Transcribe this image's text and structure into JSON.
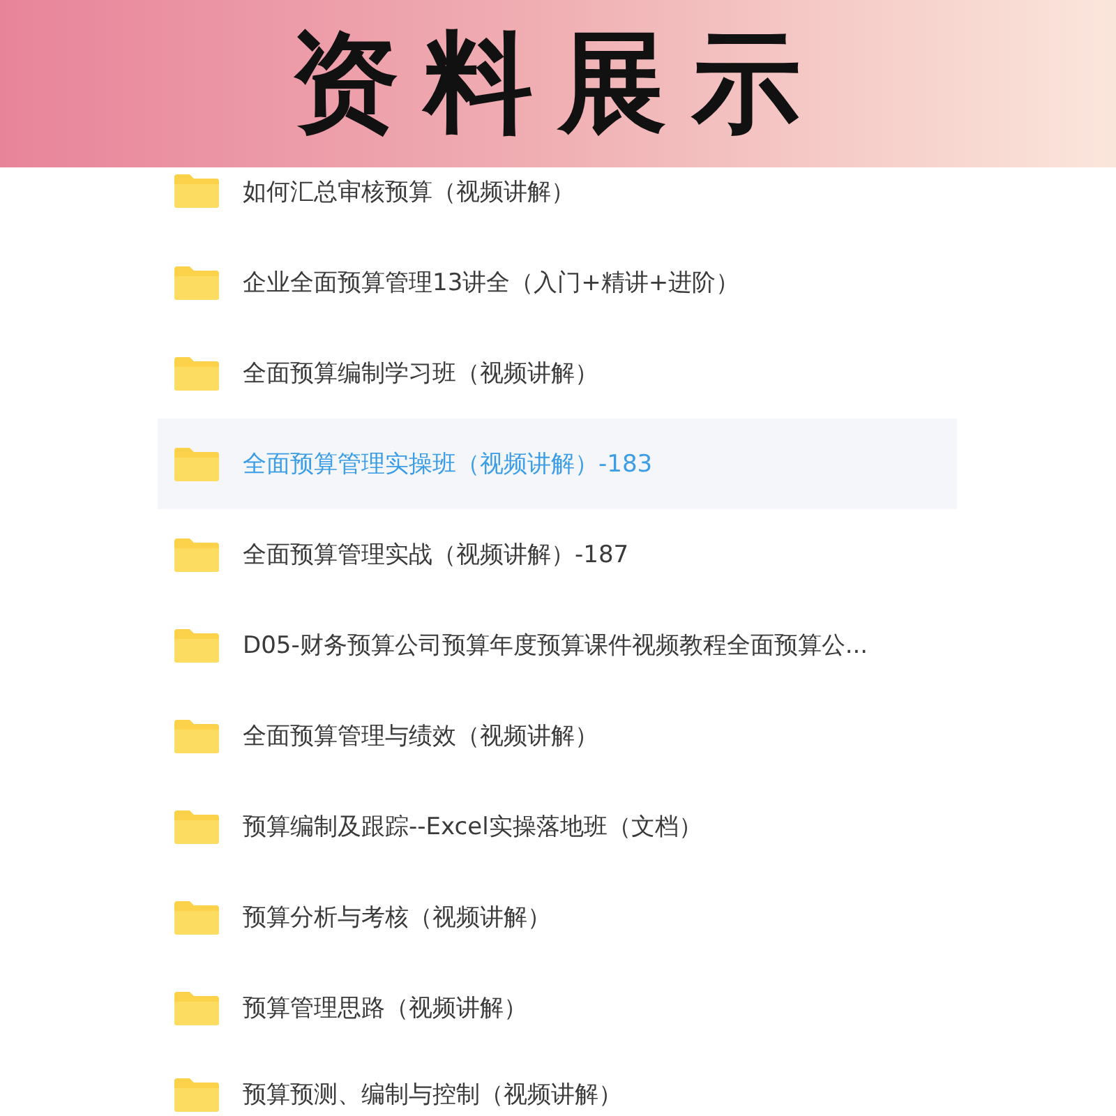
{
  "banner": {
    "title": "资料展示"
  },
  "folders": [
    {
      "name": "如何汇总审核预算（视频讲解）",
      "selected": false
    },
    {
      "name": "企业全面预算管理13讲全（入门+精讲+进阶）",
      "selected": false
    },
    {
      "name": "全面预算编制学习班（视频讲解）",
      "selected": false
    },
    {
      "name": "全面预算管理实操班（视频讲解）-183",
      "selected": true
    },
    {
      "name": "全面预算管理实战（视频讲解）-187",
      "selected": false
    },
    {
      "name": "D05-财务预算公司预算年度预算课件视频教程全面预算公...",
      "selected": false
    },
    {
      "name": "全面预算管理与绩效（视频讲解）",
      "selected": false
    },
    {
      "name": "预算编制及跟踪--Excel实操落地班（文档）",
      "selected": false
    },
    {
      "name": "预算分析与考核（视频讲解）",
      "selected": false
    },
    {
      "name": "预算管理思路（视频讲解）",
      "selected": false
    },
    {
      "name": "预算预测、编制与控制（视频讲解）",
      "selected": false
    }
  ]
}
